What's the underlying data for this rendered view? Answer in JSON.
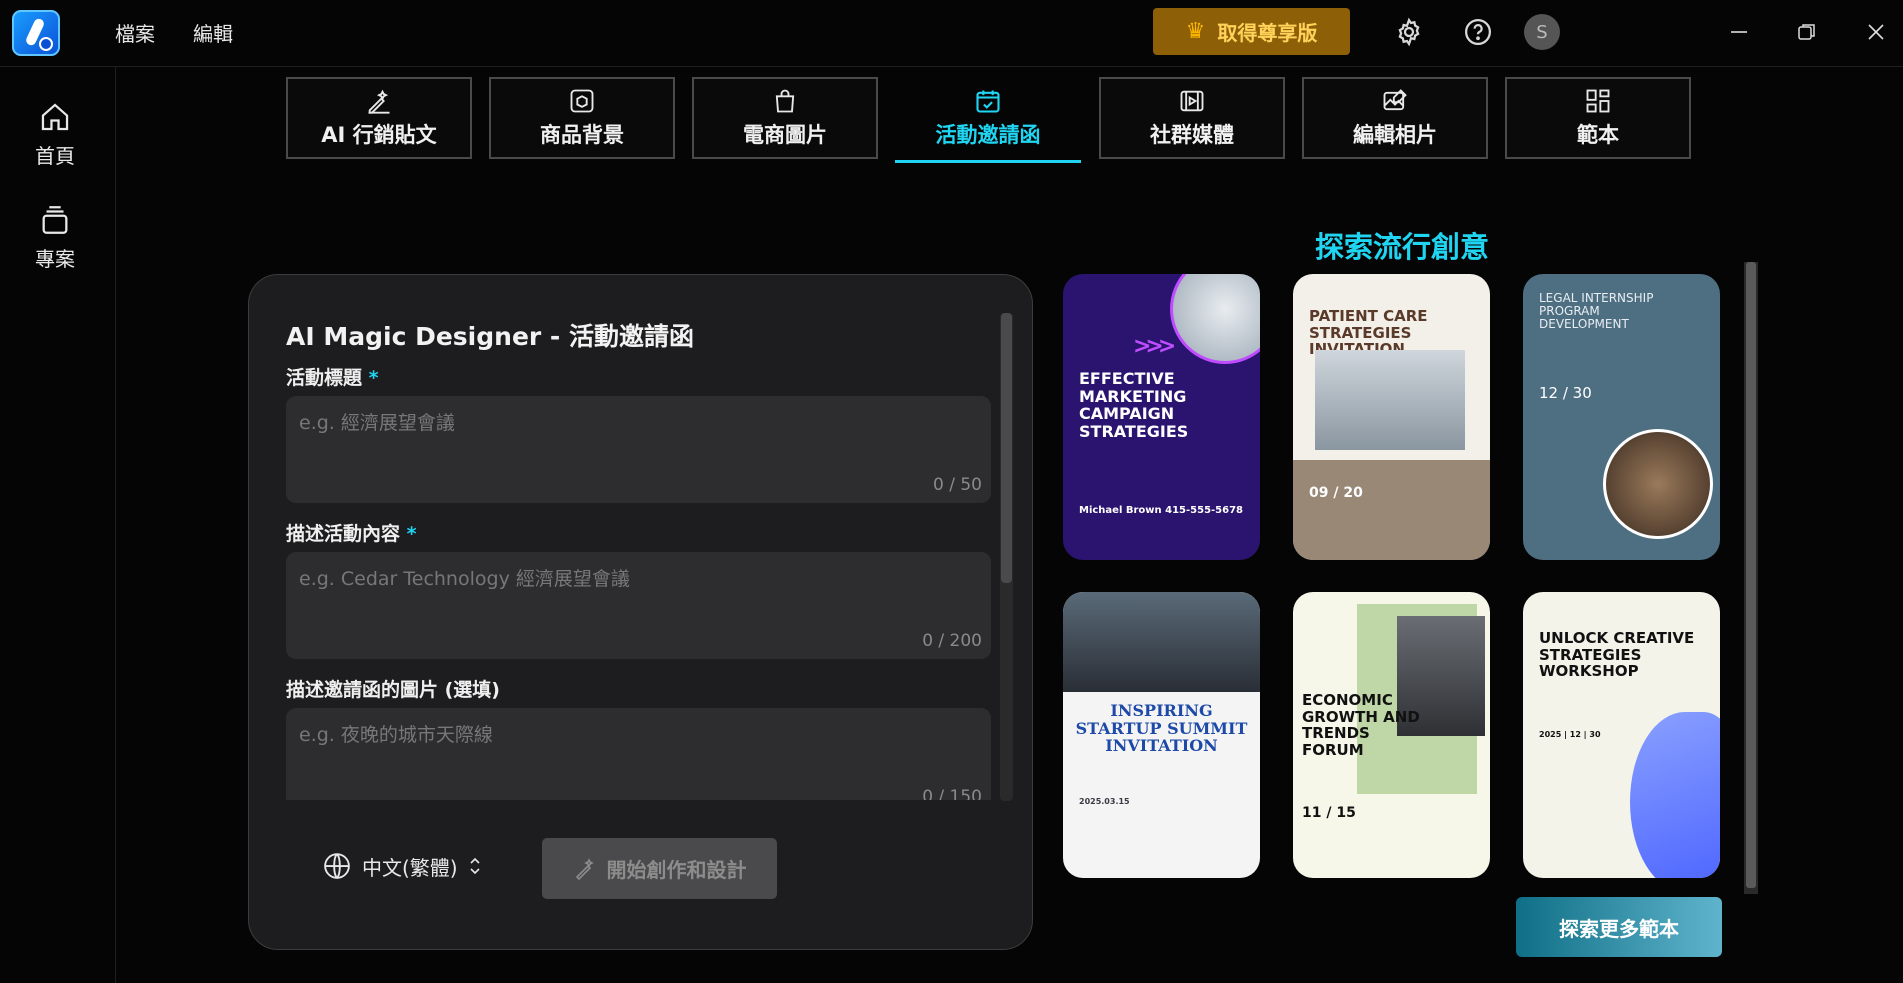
{
  "menu": {
    "file": "檔案",
    "edit": "編輯"
  },
  "toolbar": {
    "vip_label": "取得尊享版",
    "avatar_letter": "S"
  },
  "sidebar": {
    "home": "首頁",
    "projects": "專案"
  },
  "tabs": [
    {
      "label": "AI 行銷貼文",
      "icon": "magic-pen-icon"
    },
    {
      "label": "商品背景",
      "icon": "product-bg-icon"
    },
    {
      "label": "電商圖片",
      "icon": "shopping-bag-icon"
    },
    {
      "label": "活動邀請函",
      "icon": "calendar-check-icon",
      "active": true
    },
    {
      "label": "社群媒體",
      "icon": "video-frame-icon"
    },
    {
      "label": "編輯相片",
      "icon": "photo-edit-icon"
    },
    {
      "label": "範本",
      "icon": "grid-icon"
    }
  ],
  "form": {
    "title": "AI Magic Designer - 活動邀請函",
    "fields": [
      {
        "label": "活動標題",
        "required": "*",
        "placeholder": "e.g. 經濟展望會議",
        "counter": "0 / 50"
      },
      {
        "label": "描述活動內容",
        "required": "*",
        "placeholder": "e.g. Cedar Technology 經濟展望會議",
        "counter": "0 / 200"
      },
      {
        "label": "描述邀請函的圖片 (選填)",
        "placeholder": "e.g. 夜晚的城市天際線",
        "counter": "0 / 150"
      }
    ],
    "language": "中文(繁體)",
    "create_label": "開始創作和設計"
  },
  "explore": {
    "title": "探索流行創意",
    "more_label": "探索更多範本",
    "cards": [
      {
        "title": "EFFECTIVE MARKETING CAMPAIGN STRATEGIES",
        "detail": "Michael Brown 415-555-5678",
        "colors": {
          "bg": "#2a1470",
          "fg": "#ffffff",
          "accent": "#c04cff"
        }
      },
      {
        "title": "PATIENT CARE STRATEGIES INVITATION",
        "detail": "09 / 20",
        "colors": {
          "bg": "#9a8877",
          "fg": "#5a3a28",
          "accent": "#f3efe9"
        }
      },
      {
        "title": "LEGAL INTERNSHIP PROGRAM DEVELOPMENT",
        "detail": "12 / 30",
        "colors": {
          "bg": "#4e6e82",
          "fg": "#e8eef2",
          "accent": "#ffffff"
        }
      },
      {
        "title": "INSPIRING STARTUP SUMMIT INVITATION",
        "detail": "2025.03.15",
        "colors": {
          "bg": "#f4f4f4",
          "fg": "#1d4aa8",
          "accent": "#3a3a44"
        }
      },
      {
        "title": "ECONOMIC GROWTH AND TRENDS FORUM",
        "detail": "11 / 15",
        "colors": {
          "bg": "#f6f7e8",
          "fg": "#111111",
          "accent": "#bfd6a6"
        }
      },
      {
        "title": "UNLOCK CREATIVE STRATEGIES WORKSHOP",
        "detail": "2025 | 12 | 30",
        "colors": {
          "bg": "#f3f3ea",
          "fg": "#111111",
          "accent": "#4a63ff"
        }
      }
    ]
  }
}
